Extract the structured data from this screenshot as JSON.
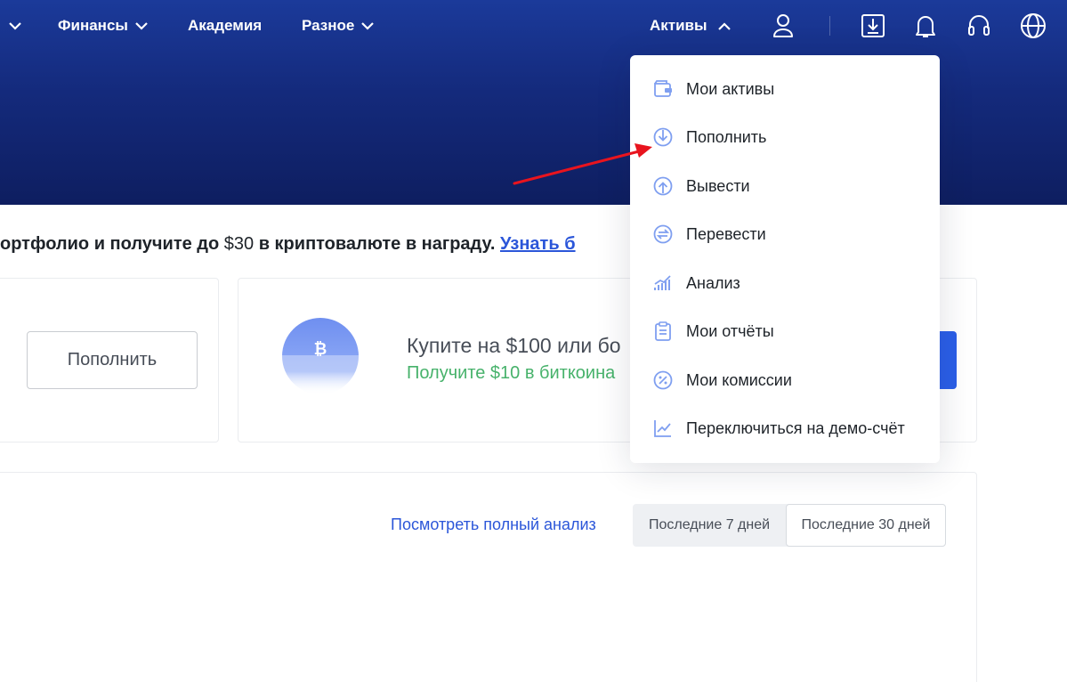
{
  "nav": {
    "items": [
      {
        "label": "Финансы"
      },
      {
        "label": "Академия"
      },
      {
        "label": "Разное"
      }
    ],
    "assets_label": "Активы"
  },
  "header_icons": [
    "user-icon",
    "download-icon",
    "bell-icon",
    "headset-icon",
    "globe-icon"
  ],
  "promo": {
    "text_before": "ортфолио и получите до ",
    "amount": "$30",
    "text_after": " в криптовалюте в награду. ",
    "link": "Узнать б"
  },
  "deposit_card": {
    "button_label": "Пополнить"
  },
  "buy_card": {
    "title": "Купите на $100 или бо",
    "subtitle": "Получите $10 в биткоина"
  },
  "analysis": {
    "link": "Посмотреть полный анализ",
    "periods": [
      "Последние 7 дней",
      "Последние 30 дней"
    ],
    "selected": "Последние 30 дней"
  },
  "dropdown": {
    "items": [
      {
        "label": "Мои активы",
        "icon": "wallet-icon"
      },
      {
        "label": "Пополнить",
        "icon": "deposit-icon"
      },
      {
        "label": "Вывести",
        "icon": "withdraw-icon"
      },
      {
        "label": "Перевести",
        "icon": "transfer-icon"
      },
      {
        "label": "Анализ",
        "icon": "analysis-icon"
      },
      {
        "label": "Мои отчёты",
        "icon": "report-icon"
      },
      {
        "label": "Мои комиссии",
        "icon": "fee-icon"
      },
      {
        "label": "Переключиться на демо-счёт",
        "icon": "demo-chart-icon"
      }
    ]
  },
  "colors": {
    "header_top": "#1b3a9a",
    "header_bottom": "#0e1e60",
    "link_blue": "#2b56d9",
    "green": "#47b26b",
    "icon_blue": "#7f9ff0",
    "arrow_red": "#e8141e"
  }
}
